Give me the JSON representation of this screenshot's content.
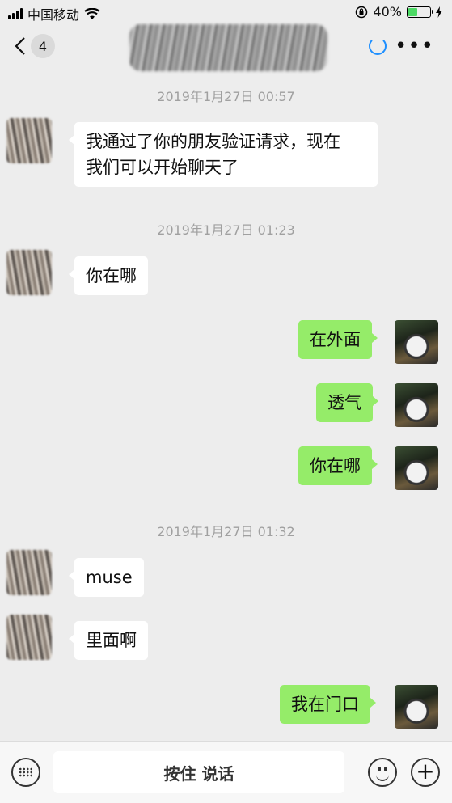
{
  "status": {
    "carrier": "中国移动",
    "battery": "40%",
    "signal_icon": "signal-bars-icon",
    "wifi_icon": "wifi-icon",
    "lock_icon": "orientation-lock-icon",
    "charging_icon": "charging-bolt-icon"
  },
  "nav": {
    "back_badge": "4",
    "title_obscured": true
  },
  "messages": [
    {
      "type": "time",
      "text": "2019年1月27日 00:57"
    },
    {
      "type": "in",
      "text_line1": "我通过了你的朋友验证请求，现在",
      "text_line2": "我们可以开始聊天了"
    },
    {
      "type": "time",
      "text": "2019年1月27日 01:23"
    },
    {
      "type": "in",
      "text": "你在哪"
    },
    {
      "type": "out",
      "text": "在外面"
    },
    {
      "type": "out",
      "text": "透气"
    },
    {
      "type": "out",
      "text": "你在哪"
    },
    {
      "type": "time",
      "text": "2019年1月27日 01:32"
    },
    {
      "type": "in",
      "text": "muse"
    },
    {
      "type": "in",
      "text": "里面啊"
    },
    {
      "type": "out",
      "text": "我在门口"
    }
  ],
  "input": {
    "hold_to_talk": "按住 说话"
  },
  "colors": {
    "background": "#EDEDED",
    "out_bubble": "#95EC69",
    "in_bubble": "#FFFFFF",
    "accent": "#1E8FFF"
  }
}
